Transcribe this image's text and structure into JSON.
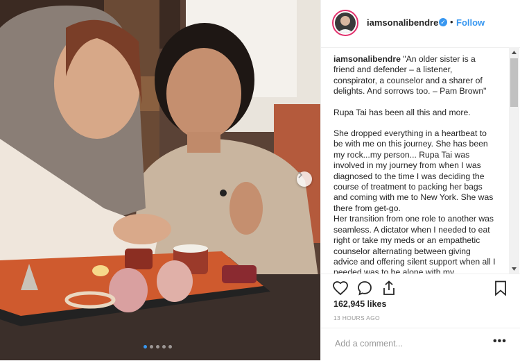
{
  "post": {
    "username": "iamsonalibendre",
    "verified_icon": "verified-badge-icon",
    "bullet": "•",
    "follow_label": "Follow",
    "caption_username": "iamsonalibendre",
    "caption_paragraphs": [
      "\"An older sister is a friend and defender – a listener, conspirator, a counselor and a sharer of delights. And sorrows too. – Pam Brown\"",
      "Rupa Tai has been all this and more.",
      "She dropped everything in a heartbeat to be with me on this journey. She has been my rock...my person... Rupa Tai was involved in my journey from when I was diagnosed to the time I was deciding the course of treatment to packing her bags and coming with me to New York. She was there from get-go.",
      "Her transition from one role to another was seamless. A dictator when I needed to eat right or take my meds or an empathetic counselor alternating between giving advice and offering silent support when all I needed was to be alone with my"
    ],
    "likes": "162,945 likes",
    "timestamp": "13 HOURS AGO",
    "comment_placeholder": "Add a comment...",
    "more_label": "•••"
  },
  "carousel": {
    "dot_count": 5,
    "active_index": 0
  },
  "colors": {
    "accent": "#3897f0",
    "text": "#262626",
    "muted": "#999999",
    "border": "#efefef"
  }
}
